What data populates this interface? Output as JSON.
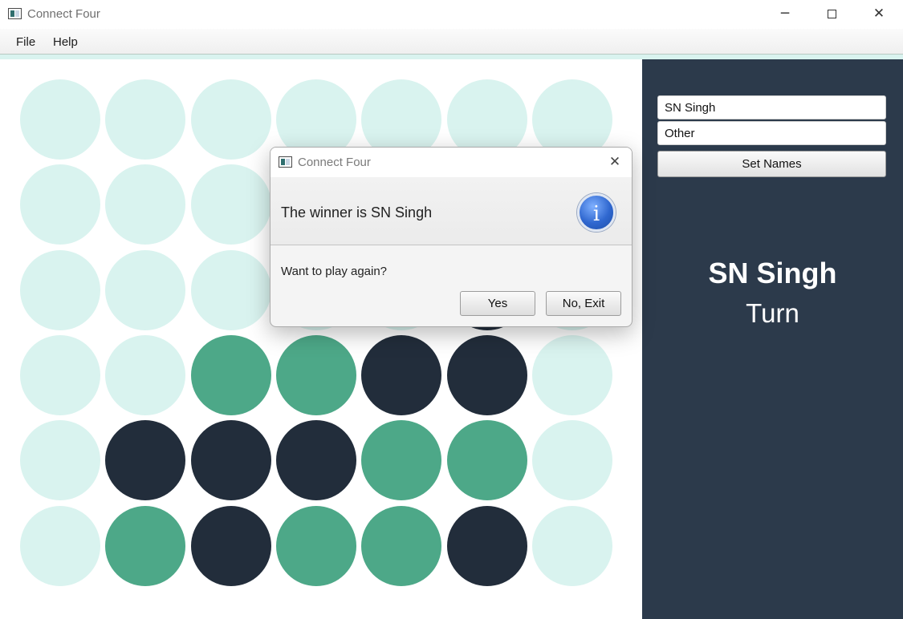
{
  "window": {
    "title": "Connect Four",
    "icon": "app-window-icon",
    "controls": {
      "minimize": "─",
      "maximize": "",
      "close": "✕"
    }
  },
  "menu": {
    "items": [
      {
        "label": "File"
      },
      {
        "label": "Help"
      }
    ]
  },
  "colors": {
    "empty": "#d9f3ef",
    "player1": "#4da888",
    "player2": "#222d3b",
    "sidebar": "#2c3a4b",
    "accent": "#d9f3ef"
  },
  "board": {
    "rows": [
      [
        "empty",
        "empty",
        "empty",
        "empty",
        "empty",
        "empty",
        "empty"
      ],
      [
        "empty",
        "empty",
        "empty",
        "empty",
        "empty",
        "empty",
        "empty"
      ],
      [
        "empty",
        "empty",
        "empty",
        "empty",
        "empty",
        "player2",
        "empty"
      ],
      [
        "empty",
        "empty",
        "player1",
        "player1",
        "player2",
        "player2",
        "empty"
      ],
      [
        "empty",
        "player2",
        "player2",
        "player2",
        "player1",
        "player1",
        "empty"
      ],
      [
        "empty",
        "player1",
        "player2",
        "player1",
        "player1",
        "player2",
        "empty"
      ]
    ]
  },
  "sidebar": {
    "player1_name": "SN Singh",
    "player2_name": "Other",
    "set_names_label": "Set Names",
    "current_player": "SN Singh",
    "turn_label": "Turn"
  },
  "dialog": {
    "title": "Connect Four",
    "header": "The winner is SN Singh",
    "icon": "info-icon",
    "info_glyph": "i",
    "content": "Want to play again?",
    "yes_label": "Yes",
    "no_label": "No, Exit",
    "close": "✕"
  }
}
